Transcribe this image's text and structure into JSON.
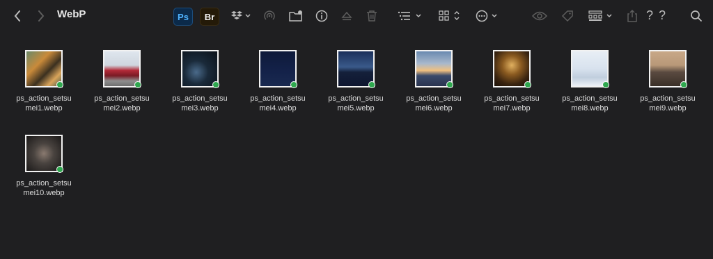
{
  "window": {
    "title": "WebP"
  },
  "toolbar": {
    "ps_label": "Ps",
    "br_label": "Br",
    "help_1": "?",
    "help_2": "?"
  },
  "files": [
    {
      "line1": "ps_action_setsu",
      "line2": "mei1.webp"
    },
    {
      "line1": "ps_action_setsu",
      "line2": "mei2.webp"
    },
    {
      "line1": "ps_action_setsu",
      "line2": "mei3.webp"
    },
    {
      "line1": "ps_action_setsu",
      "line2": "mei4.webp"
    },
    {
      "line1": "ps_action_setsu",
      "line2": "mei5.webp"
    },
    {
      "line1": "ps_action_setsu",
      "line2": "mei6.webp"
    },
    {
      "line1": "ps_action_setsu",
      "line2": "mei7.webp"
    },
    {
      "line1": "ps_action_setsu",
      "line2": "mei8.webp"
    },
    {
      "line1": "ps_action_setsu",
      "line2": "mei9.webp"
    },
    {
      "line1": "ps_action_setsu",
      "line2": "mei10.webp"
    }
  ],
  "icons": {
    "back": "chevron-left-icon",
    "forward": "chevron-right-icon",
    "dropbox": "dropbox-icon",
    "airdrop": "airdrop-icon",
    "new_folder": "new-folder-icon",
    "info": "info-icon",
    "eject": "eject-icon",
    "trash": "trash-icon",
    "list_view": "list-view-icon",
    "grid_view": "grid-view-icon",
    "more": "more-icon",
    "preview": "eye-icon",
    "tag": "tag-icon",
    "group": "group-icon",
    "share": "share-icon",
    "search": "search-icon"
  },
  "colors": {
    "background": "#1f1f21",
    "sync_badge": "#2fa84f"
  }
}
